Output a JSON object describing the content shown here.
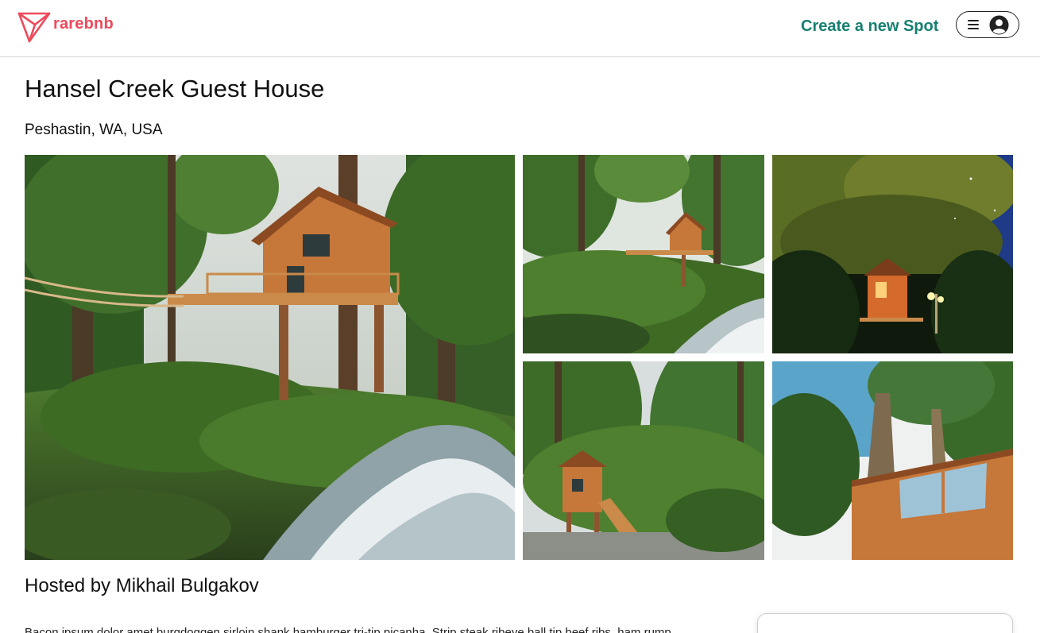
{
  "brand": {
    "name": "rarebnb",
    "accent": "#ee4a5c"
  },
  "nav": {
    "create_spot_label": "Create a new Spot",
    "create_spot_color": "#16806f",
    "menu_icon": "hamburger-menu-icon",
    "user_icon": "user-circle-icon"
  },
  "spot": {
    "name": "Hansel Creek Guest House",
    "location": "Peshastin, WA, USA",
    "host_heading": "Hosted by Mikhail Bulgakov",
    "description": "Bacon ipsum dolor amet burgdoggen sirloin shank hamburger tri-tip picanha. Strip steak ribeye ball tip beef ribs, ham rump"
  },
  "images": [
    {
      "alt": "Treehouse with rope bridge above a rushing creek in a pine forest"
    },
    {
      "alt": "Treehouse on stilts at the edge of a mossy creek bank"
    },
    {
      "alt": "Treehouse lit up at night under a starry sky"
    },
    {
      "alt": "Wooden walkway leading up to the treehouse among tall trees"
    },
    {
      "alt": "Looking up a tall pine trunk at the treehouse windows"
    }
  ]
}
